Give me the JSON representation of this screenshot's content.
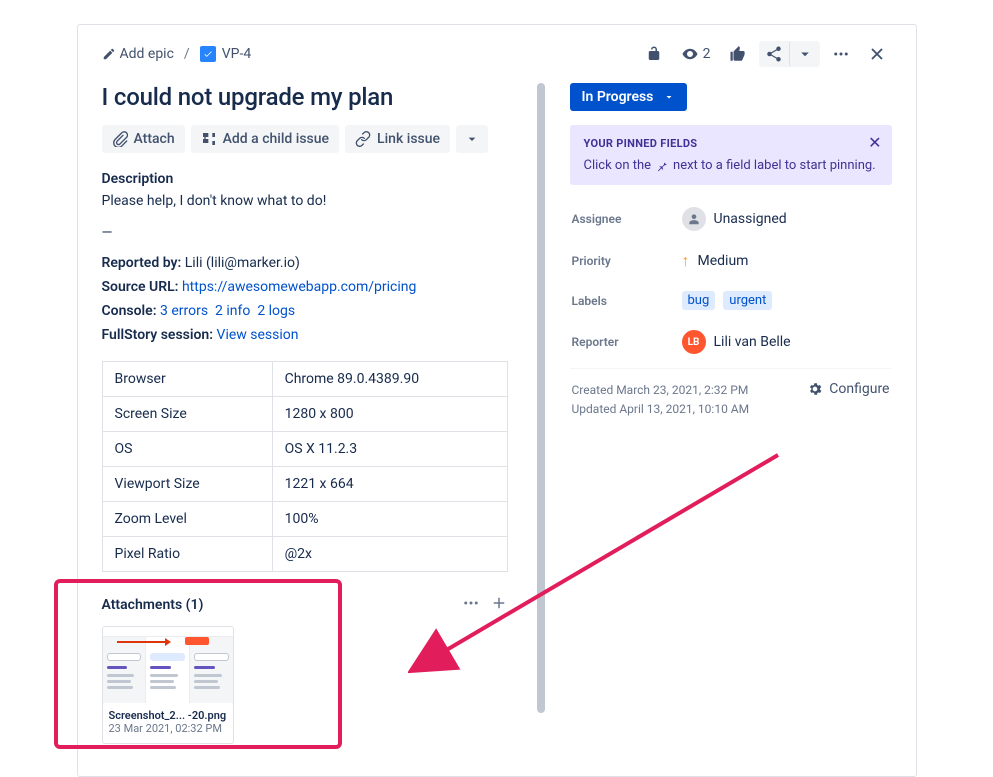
{
  "crumbs": {
    "add_epic": "Add epic",
    "issue_key": "VP-4"
  },
  "top_actions": {
    "watch_count": "2"
  },
  "title": "I could not upgrade my plan",
  "actions": {
    "attach": "Attach",
    "add_child": "Add a child issue",
    "link_issue": "Link issue"
  },
  "description": {
    "heading": "Description",
    "text": "Please help, I don't know what to do!",
    "dash": "—"
  },
  "meta": {
    "reported_by_label": "Reported by:",
    "reported_by_value": "Lili (lili@marker.io)",
    "source_url_label": "Source URL:",
    "source_url_value": "https://awesomewebapp.com/pricing",
    "console_label": "Console:",
    "console_errors": "3 errors",
    "console_info": "2 info",
    "console_logs": "2 logs",
    "fullstory_label": "FullStory session:",
    "fullstory_link": "View session"
  },
  "env": {
    "rows": [
      {
        "k": "Browser",
        "v": "Chrome 89.0.4389.90"
      },
      {
        "k": "Screen Size",
        "v": "1280 x 800"
      },
      {
        "k": "OS",
        "v": "OS X 11.2.3"
      },
      {
        "k": "Viewport Size",
        "v": "1221 x 664"
      },
      {
        "k": "Zoom Level",
        "v": "100%"
      },
      {
        "k": "Pixel Ratio",
        "v": "@2x"
      }
    ]
  },
  "attachments": {
    "heading": "Attachments (1)",
    "file_name": "Screenshot_2... -20.png",
    "file_date": "23 Mar 2021, 02:32 PM"
  },
  "status": {
    "label": "In Progress"
  },
  "pinned": {
    "title": "YOUR PINNED FIELDS",
    "text_before": "Click on the",
    "text_after": "next to a field label to start pinning."
  },
  "fields": {
    "assignee_label": "Assignee",
    "assignee_value": "Unassigned",
    "priority_label": "Priority",
    "priority_value": "Medium",
    "labels_label": "Labels",
    "labels": [
      "bug",
      "urgent"
    ],
    "reporter_label": "Reporter",
    "reporter_initials": "LB",
    "reporter_value": "Lili van Belle"
  },
  "footer": {
    "created": "Created March 23, 2021, 2:32 PM",
    "updated": "Updated April 13, 2021, 10:10 AM",
    "configure": "Configure"
  }
}
